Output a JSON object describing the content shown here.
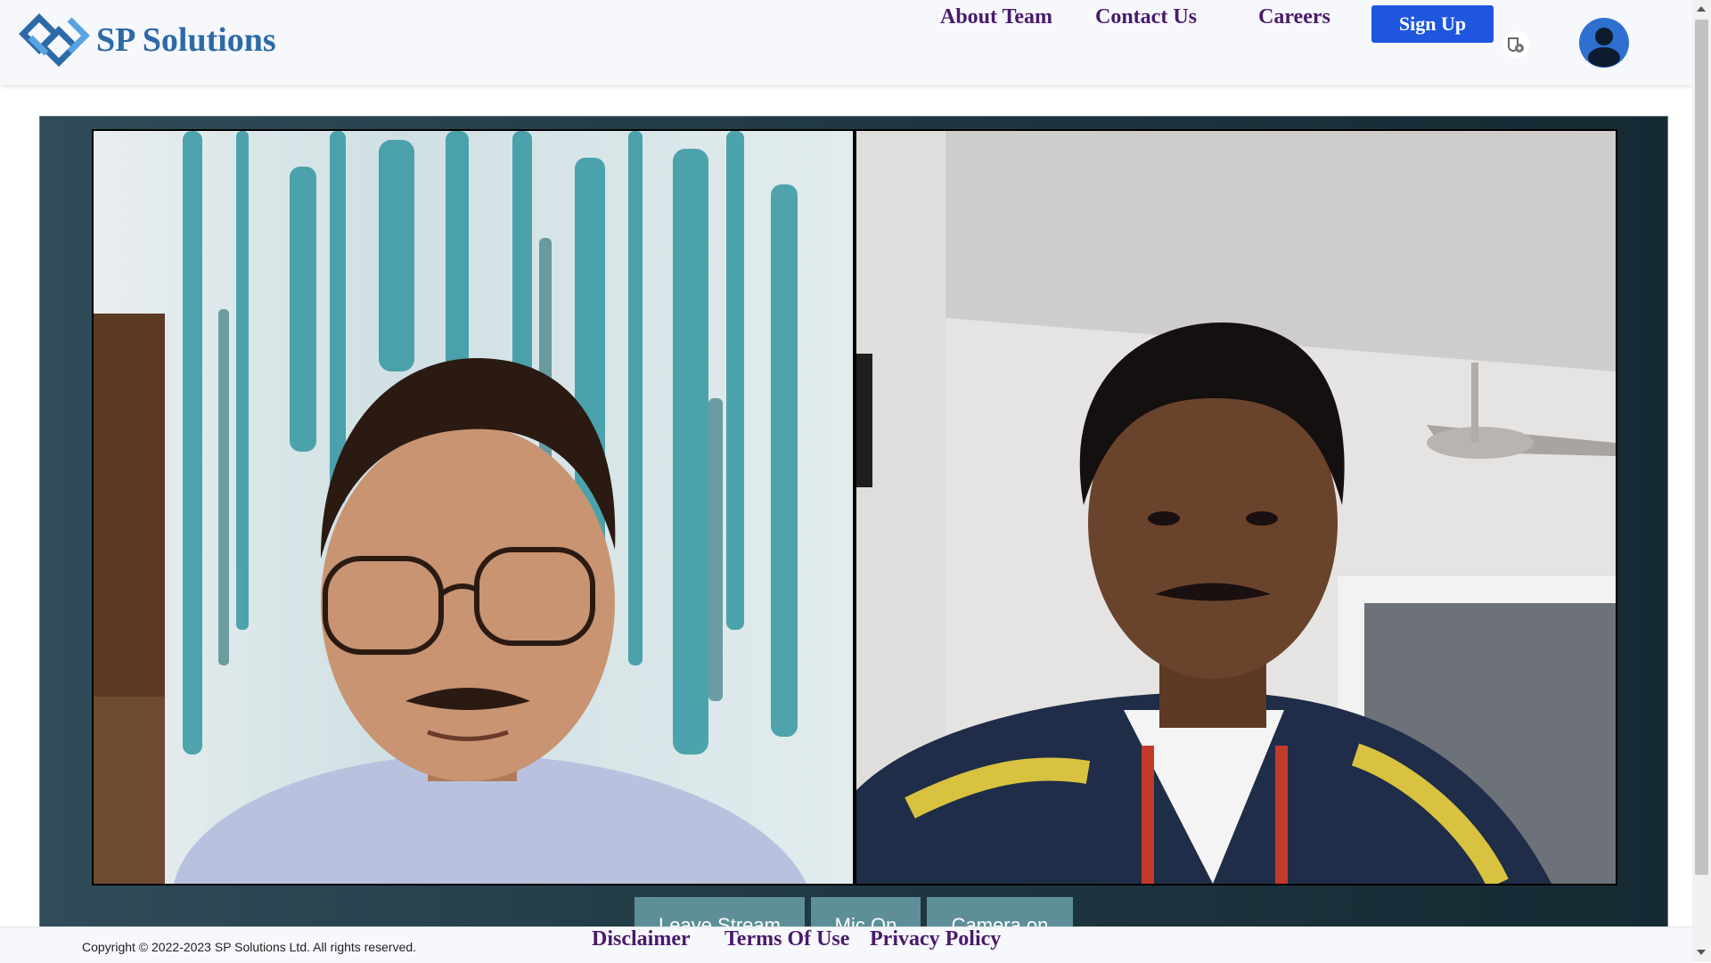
{
  "brand": {
    "name": "SP Solutions",
    "logo_icon": "diamond-chain-logo",
    "color": "#2d6aa8"
  },
  "nav": {
    "about": "About Team",
    "contact": "Contact Us",
    "careers": "Careers",
    "signup": "Sign Up",
    "link_color": "#4a1a6b",
    "signup_color": "#1e56e0"
  },
  "header_icons": {
    "extension": "extension-shield-icon",
    "profile": "user-avatar-icon"
  },
  "stream": {
    "participants": [
      {
        "name": "participant-1",
        "shown": "camera feed of a man with glasses in front of a teal patterned curtain"
      },
      {
        "name": "participant-2",
        "shown": "camera feed of a man in a striped jacket in a room with a ceiling fan"
      }
    ],
    "controls": {
      "leave": "Leave Stream",
      "mic": "Mic On",
      "camera": "Camera on"
    },
    "control_color": "#5e8f98"
  },
  "footer": {
    "copyright": "Copyright © 2022-2023 SP Solutions Ltd. All rights reserved.",
    "disclaimer": "Disclaimer",
    "terms": "Terms Of Use",
    "privacy": "Privacy Policy"
  }
}
